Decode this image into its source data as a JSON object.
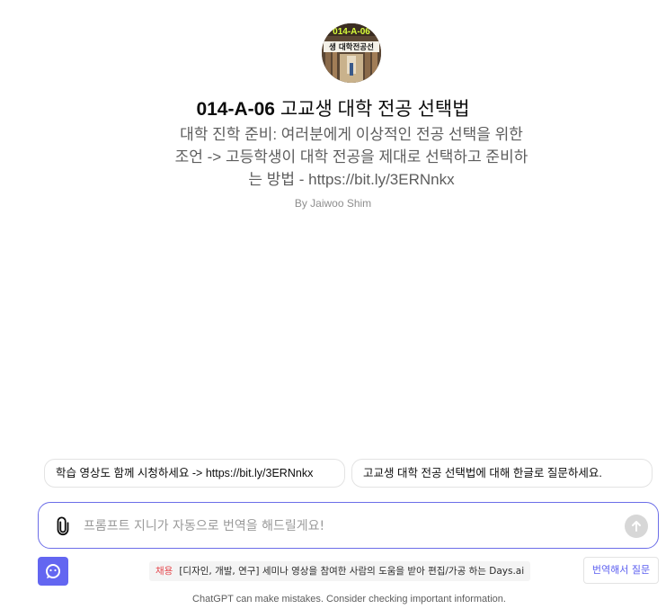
{
  "gpt": {
    "avatar_text_top": "014-A-06",
    "avatar_text_bottom": "생 대학전공선",
    "title_code": "014-A-06",
    "title_name": "고교생 대학 전공 선택법",
    "description": "대학 진학 준비: 여러분에게 이상적인 전공 선택을 위한 조언 -> 고등학생이 대학 전공을 제대로 선택하고 준비하는 방법 - https://bit.ly/3ERNnkx",
    "author": "By Jaiwoo Shim"
  },
  "suggestions": [
    {
      "label": "학습 영상도 함께 시청하세요 -> https://bit.ly/3ERNnkx"
    },
    {
      "label": "고교생 대학 전공 선택법에 대해 한글로 질문하세요."
    }
  ],
  "composer": {
    "placeholder": "프롬프트 지니가 자동으로 번역을 해드릴게요!",
    "value": ""
  },
  "toolbar": {
    "notice_tag": "채용",
    "notice_text": "[디자인, 개발, 연구] 세미나 영상을 참여한 사람의 도움을 받아 편집/가공 하는 Days.ai",
    "translate_label": "번역해서 질문"
  },
  "footer": {
    "disclaimer": "ChatGPT can make mistakes. Consider checking important information."
  },
  "icons": {
    "attach": "paperclip-icon",
    "send": "arrow-up-icon",
    "days": "chat-bubble-smile-icon"
  },
  "colors": {
    "accent": "#6366f1",
    "composer_border": "#6c6ee8",
    "notice_tag": "#e5484d",
    "send_disabled": "#d7d7d7"
  }
}
